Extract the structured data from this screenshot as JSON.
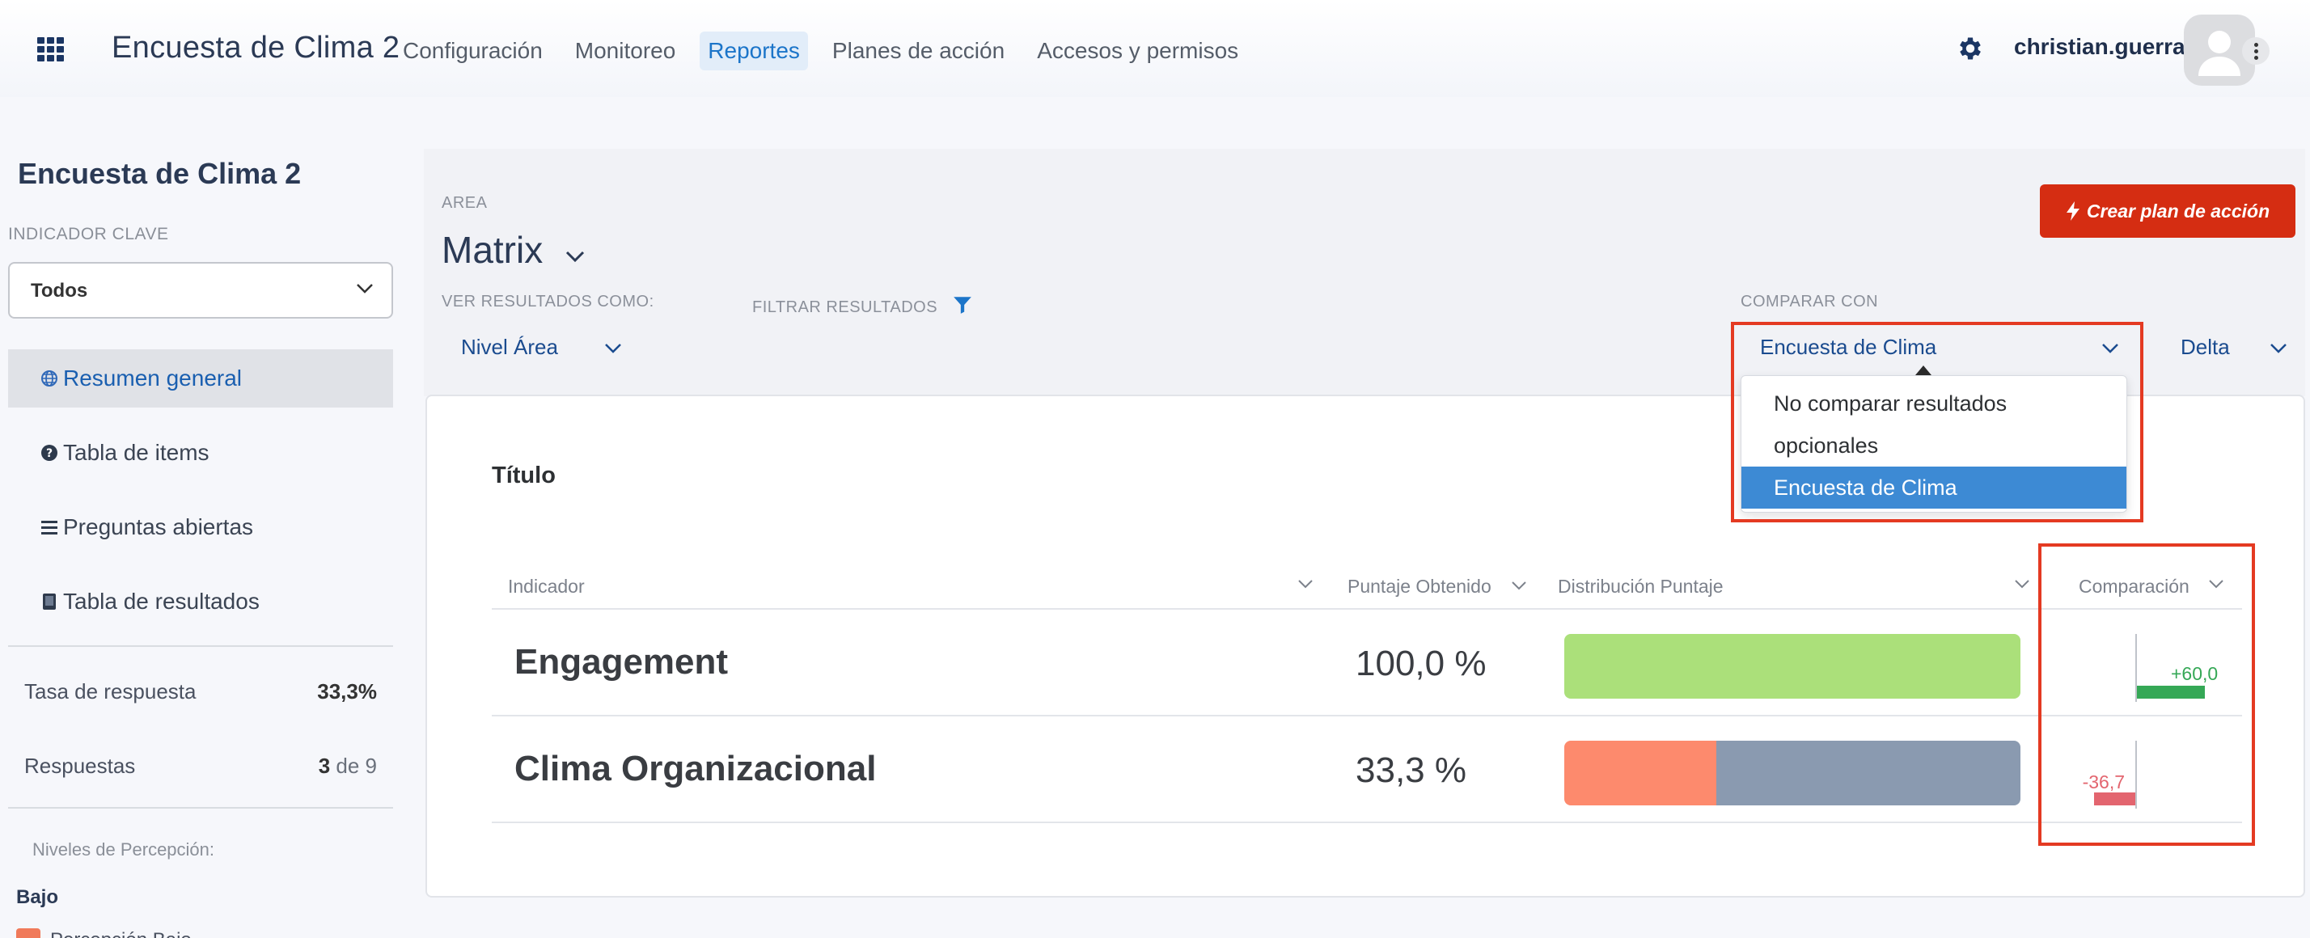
{
  "header": {
    "app_title": "Encuesta de Clima 2",
    "nav": [
      "Configuración",
      "Monitoreo",
      "Reportes",
      "Planes de acción",
      "Accesos y permisos"
    ],
    "active_nav": "Reportes",
    "username": "christian.guerra",
    "icons": [
      "apps-grid-icon",
      "gear-icon",
      "user-avatar-icon",
      "more-vertical-icon"
    ]
  },
  "sidebar": {
    "title": "Encuesta de Clima 2",
    "indicator_label": "INDICADOR CLAVE",
    "indicator_value": "Todos",
    "menu": [
      {
        "label": "Resumen general",
        "icon": "globe-icon",
        "active": true
      },
      {
        "label": "Tabla de items",
        "icon": "question-circle-icon",
        "active": false
      },
      {
        "label": "Preguntas abiertas",
        "icon": "list-icon",
        "active": false
      },
      {
        "label": "Tabla de resultados",
        "icon": "book-icon",
        "active": false
      }
    ],
    "response_rate_label": "Tasa de respuesta",
    "response_rate_value": "33,3%",
    "responses_label": "Respuestas",
    "responses_count": "3",
    "responses_of": "de 9",
    "perception_label": "Niveles de Percepción:",
    "level_low": "Bajo",
    "legend_low": "Percepción Bajo",
    "legend_low_color": "#f07a5a"
  },
  "filters": {
    "area_label": "AREA",
    "area_value": "Matrix",
    "view_as_label": "VER RESULTADOS COMO:",
    "view_as_value": "Nivel Área",
    "filter_label": "FILTRAR RESULTADOS",
    "compare_label": "COMPARAR CON",
    "compare_value": "Encuesta de Clima",
    "compare_mode": "Delta",
    "create_button": "Crear plan de acción"
  },
  "dropdown": {
    "options": [
      "No comparar resultados",
      "opcionales",
      "Encuesta de Clima"
    ],
    "selected": "Encuesta de Clima"
  },
  "card": {
    "title": "Título",
    "columns": {
      "indicator": "Indicador",
      "score": "Puntaje Obtenido",
      "distribution": "Distribución Puntaje",
      "comparison": "Comparación"
    },
    "rows": [
      {
        "name": "Engagement",
        "score": "100,0 %",
        "distribution": [
          {
            "share": 100,
            "color": "#abe07a"
          }
        ],
        "delta": 60.0,
        "delta_label": "+60,0"
      },
      {
        "name": "Clima Organizacional",
        "score": "33,3 %",
        "distribution": [
          {
            "share": 33.3,
            "color": "#fd8a6d"
          },
          {
            "share": 66.7,
            "color": "#8a9ab0"
          }
        ],
        "delta": -36.7,
        "delta_label": "-36,7"
      }
    ]
  },
  "colors": {
    "accent": "#1c75c9",
    "create_button": "#d52d12",
    "positive": "#35a856",
    "negative": "#e3656f",
    "highlight_box": "#e43a22"
  }
}
